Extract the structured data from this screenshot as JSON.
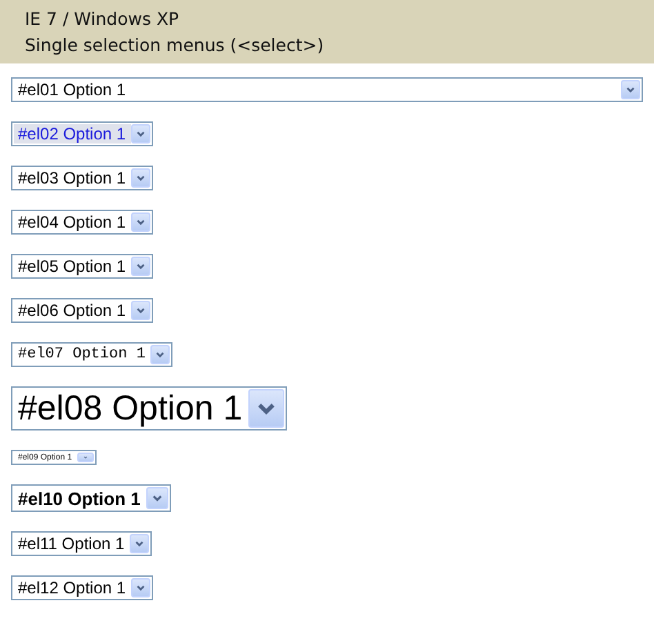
{
  "header": {
    "title": "IE 7 / Windows XP",
    "subtitle": "Single selection menus (<select>)"
  },
  "selects": [
    {
      "value": "#el01 Option 1",
      "kind": "wide"
    },
    {
      "value": "#el02 Option 1",
      "kind": "focused"
    },
    {
      "value": "#el03 Option 1",
      "kind": "normal"
    },
    {
      "value": "#el04 Option 1",
      "kind": "normal"
    },
    {
      "value": "#el05 Option 1",
      "kind": "normal"
    },
    {
      "value": "#el06 Option 1",
      "kind": "normal"
    },
    {
      "value": "#el07 Option 1",
      "kind": "mono"
    },
    {
      "value": "#el08 Option 1",
      "kind": "large"
    },
    {
      "value": "#el09 Option 1",
      "kind": "tiny"
    },
    {
      "value": "#el10 Option 1",
      "kind": "bold"
    },
    {
      "value": "#el11 Option 1",
      "kind": "normal"
    },
    {
      "value": "#el12 Option 1",
      "kind": "normal"
    }
  ]
}
